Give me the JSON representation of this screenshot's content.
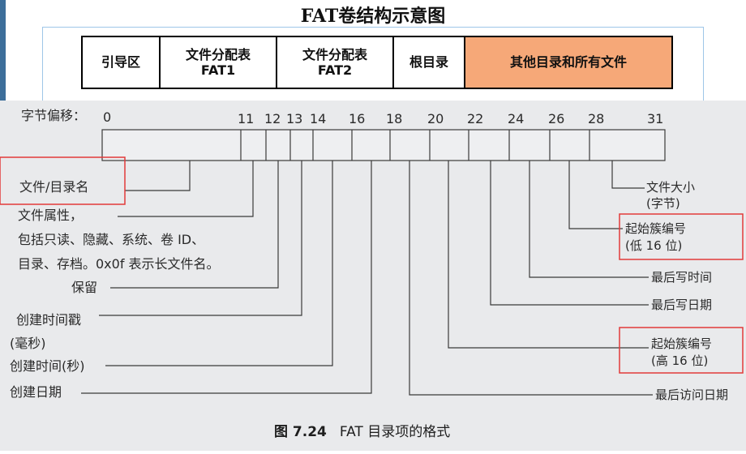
{
  "title": "FAT卷结构示意图",
  "fat_layout": [
    "引导区",
    "文件分配表\nFAT1",
    "文件分配表\nFAT2",
    "根目录",
    "其他目录和所有文件"
  ],
  "colors": {
    "highlight_cell": "#f6a878",
    "red_box": "#e23a3a"
  },
  "offset_label": "字节偏移：",
  "offsets": [
    "0",
    "11",
    "12",
    "13",
    "14",
    "16",
    "18",
    "20",
    "22",
    "24",
    "26",
    "28",
    "31"
  ],
  "left_labels": {
    "name": "文件/目录名",
    "attr_1": "文件属性，",
    "attr_2": "包括只读、隐藏、系统、卷 ID、",
    "attr_3": "目录、存档。0x0f 表示长文件名。",
    "reserved": "保留",
    "ctime_ms_1": "创建时间戳",
    "ctime_ms_2": "(毫秒)",
    "ctime_s": "创建时间(秒)",
    "cdate": "创建日期"
  },
  "right_labels": {
    "size_1": "文件大小",
    "size_2": "(字节)",
    "cluster_lo_1": "起始簇编号",
    "cluster_lo_2": "(低 16 位)",
    "last_write_time": "最后写时间",
    "last_write_date": "最后写日期",
    "cluster_hi_1": "起始簇编号",
    "cluster_hi_2": "(高 16 位)",
    "last_access_date": "最后访问日期"
  },
  "caption": {
    "num": "图 7.24",
    "text": "FAT 目录项的格式"
  }
}
